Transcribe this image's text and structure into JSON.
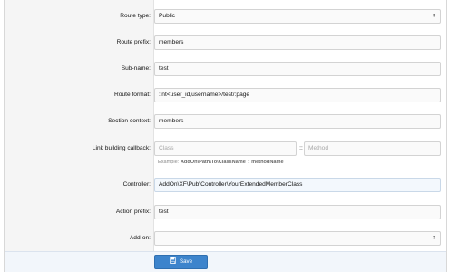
{
  "form": {
    "route_type": {
      "label": "Route type:",
      "value": "Public",
      "arrow": "⬍"
    },
    "route_prefix": {
      "label": "Route prefix:",
      "value": "members"
    },
    "sub_name": {
      "label": "Sub-name:",
      "value": "test"
    },
    "route_format": {
      "label": "Route format:",
      "value": ":int<user_id,username>/test/:page"
    },
    "section_context": {
      "label": "Section context:",
      "value": "members"
    },
    "link_building_callback": {
      "label": "Link building callback:",
      "class_placeholder": "Class",
      "separator": "::",
      "method_placeholder": "Method",
      "example_prefix": "Example:",
      "example_class": "AddOn\\Path\\To\\ClassName",
      "example_sep": "::",
      "example_method": "methodName"
    },
    "controller": {
      "label": "Controller:",
      "value": "AddOn\\XF\\Pub\\Controller\\YourExtendedMemberClass"
    },
    "action_prefix": {
      "label": "Action prefix:",
      "value": "test"
    },
    "add_on": {
      "label": "Add-on:",
      "value": "",
      "arrow": "⬍"
    }
  },
  "footer": {
    "save_label": "Save",
    "save_icon": "save-icon"
  },
  "colors": {
    "accent": "#3d84cc",
    "label_bg": "#f5f5f5",
    "input_bg": "#fafafa"
  }
}
